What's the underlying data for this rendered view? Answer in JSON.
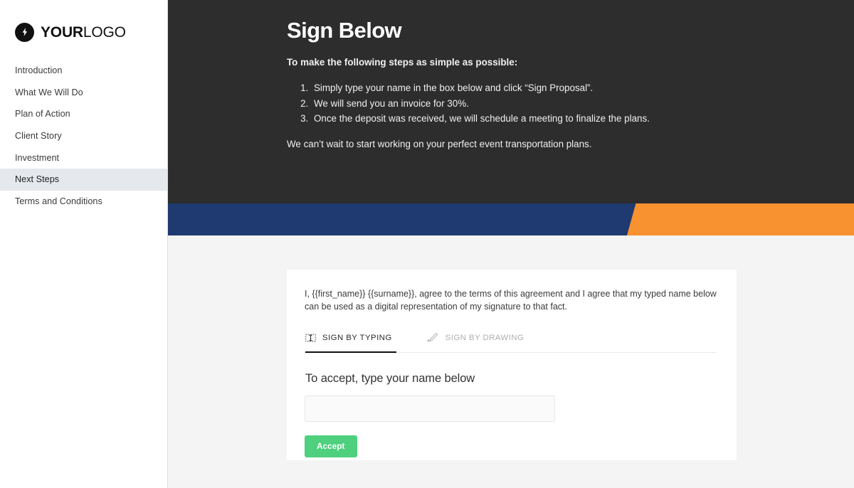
{
  "sidebar": {
    "logo": {
      "icon": "lightning-bolt-icon",
      "text_bold": "YOUR",
      "text_light": "LOGO"
    },
    "items": [
      {
        "label": "Introduction",
        "active": false
      },
      {
        "label": "What We Will Do",
        "active": false
      },
      {
        "label": "Plan of Action",
        "active": false
      },
      {
        "label": "Client Story",
        "active": false
      },
      {
        "label": "Investment",
        "active": false
      },
      {
        "label": "Next Steps",
        "active": true
      },
      {
        "label": "Terms and Conditions",
        "active": false
      }
    ]
  },
  "hero": {
    "title": "Sign Below",
    "intro": "To make the following steps as simple as possible:",
    "steps": [
      "Simply type your name in the box below and click “Sign Proposal”.",
      "We will send you an invoice for 30%.",
      "Once the deposit was received, we will schedule a meeting to finalize the plans."
    ],
    "outro": "We can’t wait to start working on your perfect event transportation plans.",
    "background": "#2d2d2d"
  },
  "banner": {
    "blue": "#1e3a70",
    "orange": "#f8912f"
  },
  "card": {
    "consent": "I, {{first_name}} {{surname}}, agree to the terms of this agreement and I agree that my typed name below can be used as a digital representation of my signature to that fact.",
    "tabs": [
      {
        "label": "SIGN BY TYPING",
        "icon": "text-cursor-icon",
        "active": true
      },
      {
        "label": "SIGN BY DRAWING",
        "icon": "pen-signature-icon",
        "active": false
      }
    ],
    "prompt": "To accept, type your name below",
    "name_input": {
      "value": "",
      "placeholder": ""
    },
    "accept_label": "Accept",
    "accept_color": "#4ed07e"
  }
}
